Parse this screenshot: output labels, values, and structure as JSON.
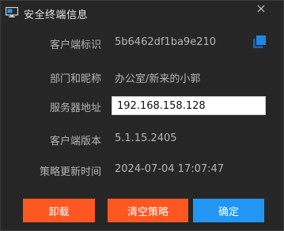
{
  "window": {
    "title": "安全终端信息",
    "icon": "monitor-icon",
    "close_icon": "close-icon"
  },
  "fields": {
    "client_id": {
      "label": "客户端标识",
      "value": "5b6462df1ba9e210"
    },
    "department": {
      "label": "部门和昵称",
      "value": "办公室/新来的小郭"
    },
    "server": {
      "label": "服务器地址",
      "value": "192.168.158.128"
    },
    "version": {
      "label": "客户端版本",
      "value": "5.1.15.2405"
    },
    "policy_time": {
      "label": "策略更新时间",
      "value": "2024-07-04 17:07:47"
    }
  },
  "buttons": {
    "uninstall": "卸载",
    "clear_policy": "清空策略",
    "confirm": "确定"
  },
  "colors": {
    "background": "#262626",
    "label_text": "#b5b5b5",
    "accent_orange": "#ff5722",
    "accent_blue": "#2196f3",
    "copy_icon": "#1e88e5"
  }
}
